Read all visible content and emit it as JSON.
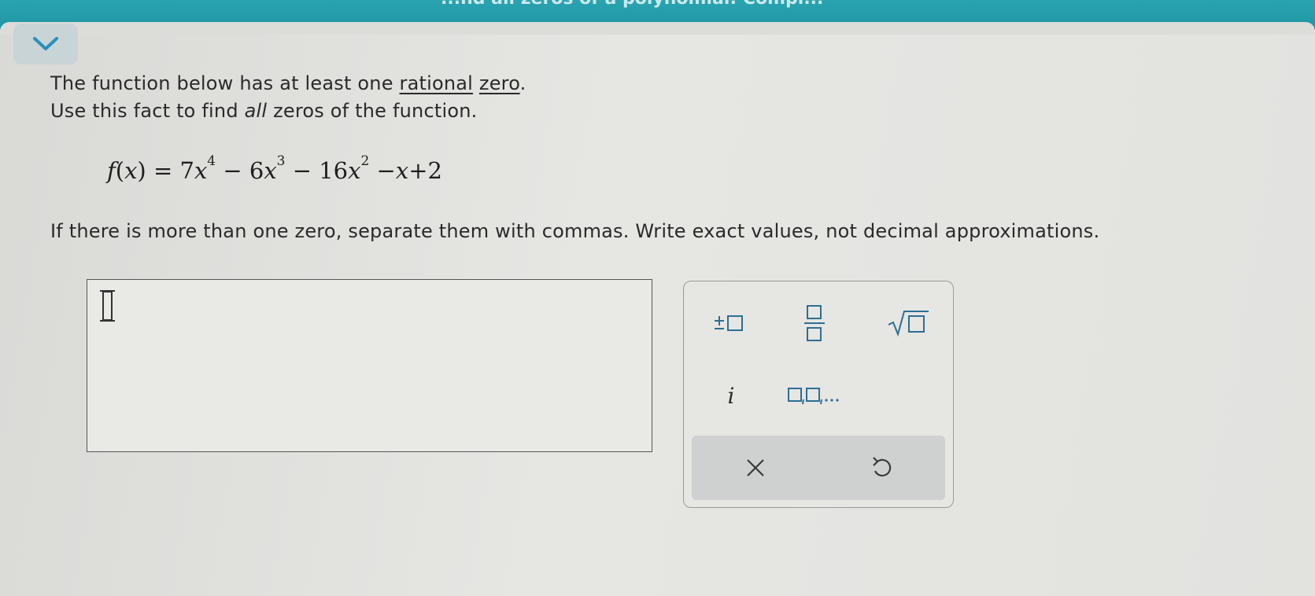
{
  "header": {
    "title": "...nd all zeros of a polynomial: Compl..."
  },
  "question": {
    "line1_before": "The function below has at least one ",
    "link_rational": "rational",
    "link_zero": "zero",
    "line1_after": ".",
    "line2_before": "Use this fact to find ",
    "line2_emphasis": "all",
    "line2_after": " zeros of the function.",
    "instructions": "If there is more than one zero, separate them with commas. Write exact values, not decimal approximations."
  },
  "formula": {
    "lhs_f": "f",
    "lhs_open": "(",
    "lhs_x": "x",
    "lhs_close": ")",
    "eq": " = 7",
    "t1_var": "x",
    "t1_exp": "4",
    "t2": " − 6",
    "t2_var": "x",
    "t2_exp": "3",
    "t3": " − 16",
    "t3_var": "x",
    "t3_exp": "2",
    "t4": " −",
    "t4_var": "x",
    "t5": "+2"
  },
  "answer": {
    "value": ""
  },
  "keypad": {
    "imaginary_label": "i",
    "list_label": "□,□,...",
    "accent": "#2c6f95",
    "keys": [
      "plus-minus",
      "fraction",
      "square-root",
      "imaginary-unit",
      "list"
    ],
    "actions": [
      "clear",
      "undo"
    ]
  },
  "colors": {
    "header": "#1f96a4",
    "collapse_button": "#c8d4d6",
    "action_bar": "#cfd1d0"
  }
}
